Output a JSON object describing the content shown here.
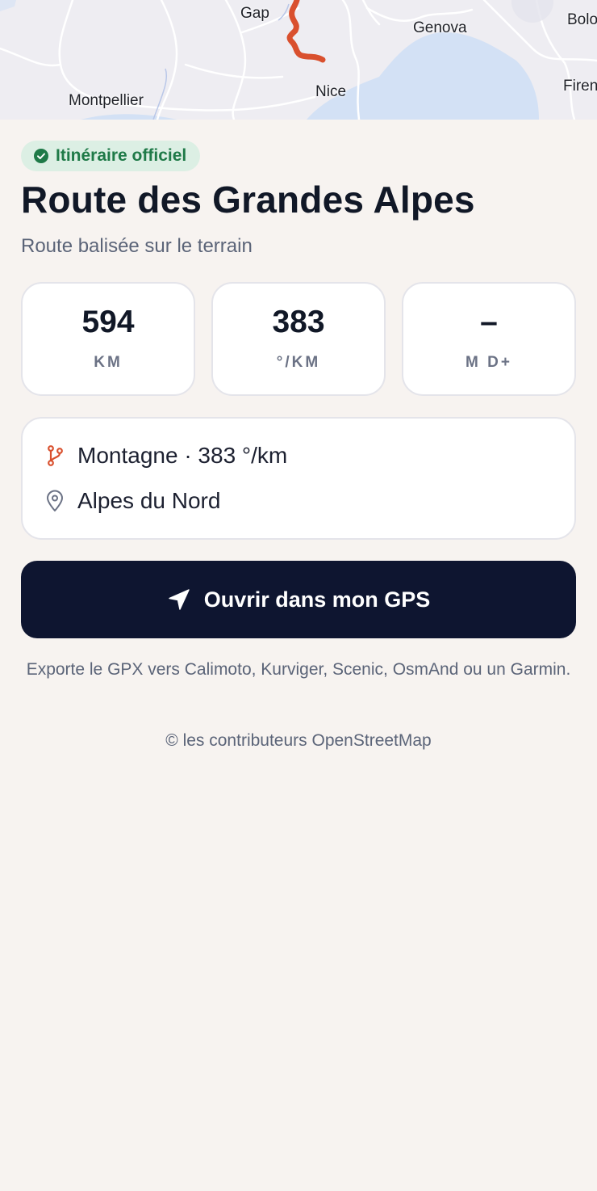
{
  "map": {
    "cities": [
      "Gap",
      "Genova",
      "Bolo",
      "Montpellier",
      "Nice",
      "Firen"
    ],
    "route_color": "#d9502e",
    "sea_color": "#d3e1f5"
  },
  "badge": {
    "label": "Itinéraire officiel",
    "color": "#1f7a48"
  },
  "route": {
    "title": "Route des Grandes Alpes",
    "subtitle": "Route balisée sur le terrain"
  },
  "stats": [
    {
      "value": "594",
      "unit": "KM"
    },
    {
      "value": "383",
      "unit": "°/KM"
    },
    {
      "value": "–",
      "unit": "M D+"
    }
  ],
  "info": {
    "type_line": "Montagne · 383 °/km",
    "region": "Alpes du Nord",
    "type_icon": "route-fork-icon",
    "region_icon": "map-pin-icon"
  },
  "gps_button": {
    "label": "Ouvrir dans mon GPS",
    "icon": "navigation-arrow-icon"
  },
  "export_note": "Exporte le GPX vers Calimoto, Kurviger, Scenic, OsmAnd ou un Garmin.",
  "credit": "© les contributeurs OpenStreetMap"
}
